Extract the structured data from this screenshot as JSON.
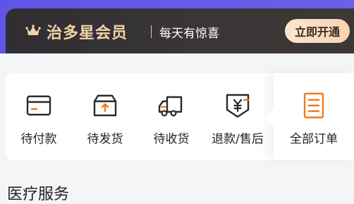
{
  "member": {
    "title": "治多星会员",
    "subtitle": "每天有惊喜",
    "button_label": "立即开通",
    "crown_icon": "crown-icon"
  },
  "orders": {
    "items": [
      {
        "label": "待付款",
        "icon": "wallet-card-icon"
      },
      {
        "label": "待发货",
        "icon": "box-upload-icon"
      },
      {
        "label": "待收货",
        "icon": "delivery-truck-icon"
      },
      {
        "label": "退款/售后",
        "icon": "refund-yen-icon"
      }
    ],
    "all_label": "全部订单",
    "all_icon": "document-list-icon"
  },
  "section": {
    "title": "医疗服务"
  },
  "colors": {
    "accent_orange": "#f07a1a",
    "dark_line": "#2a2a2a",
    "member_gold": "#f4d3a7"
  }
}
